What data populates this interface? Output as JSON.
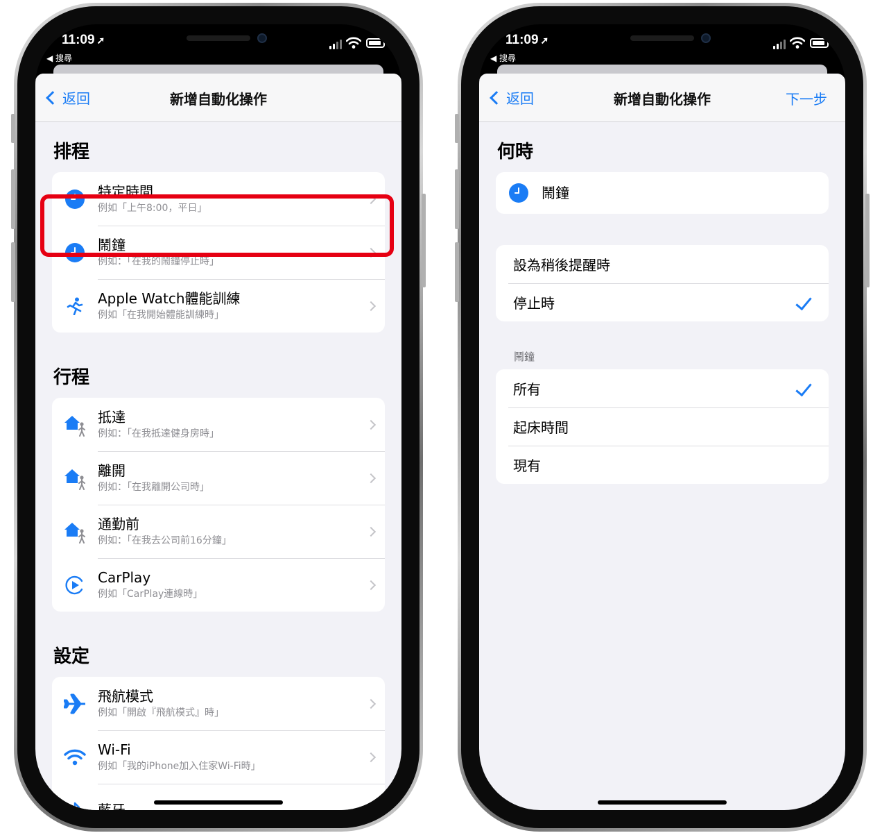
{
  "status_bar": {
    "time": "11:09",
    "back_app": "◀ 搜尋"
  },
  "left_screen": {
    "nav": {
      "back_label": "返回",
      "title": "新增自動化操作"
    },
    "sections": [
      {
        "header": "排程",
        "items": [
          {
            "icon": "clock-icon",
            "title": "特定時間",
            "subtitle": "例如「上午8:00，平日」"
          },
          {
            "icon": "clock-icon",
            "title": "鬧鐘",
            "subtitle": "例如：「在我的鬧鐘停止時」"
          },
          {
            "icon": "running-figure-icon",
            "title": "Apple Watch體能訓練",
            "subtitle": "例如「在我開始體能訓練時」"
          }
        ]
      },
      {
        "header": "行程",
        "items": [
          {
            "icon": "home-person-icon",
            "title": "抵達",
            "subtitle": "例如：「在我抵達健身房時」"
          },
          {
            "icon": "home-person-icon",
            "title": "離開",
            "subtitle": "例如：「在我離開公司時」"
          },
          {
            "icon": "home-person-icon",
            "title": "通勤前",
            "subtitle": "例如：「在我去公司前16分鐘」"
          },
          {
            "icon": "carplay-icon",
            "title": "CarPlay",
            "subtitle": "例如「CarPlay連線時」"
          }
        ]
      },
      {
        "header": "設定",
        "items": [
          {
            "icon": "airplane-icon",
            "title": "飛航模式",
            "subtitle": "例如「開啟『飛航模式』時」"
          },
          {
            "icon": "wifi-icon",
            "title": "Wi-Fi",
            "subtitle": "例如「我的iPhone加入住家Wi-Fi時」"
          },
          {
            "icon": "bluetooth-icon",
            "title": "藍牙",
            "subtitle": ""
          }
        ]
      }
    ]
  },
  "right_screen": {
    "nav": {
      "back_label": "返回",
      "title": "新增自動化操作",
      "next_label": "下一步"
    },
    "when_header": "何時",
    "trigger": {
      "icon": "clock-icon",
      "title": "鬧鐘"
    },
    "event_options": [
      {
        "label": "設為稍後提醒時",
        "checked": false
      },
      {
        "label": "停止時",
        "checked": true
      }
    ],
    "alarm_group_label": "鬧鐘",
    "alarm_options": [
      {
        "label": "所有",
        "checked": true
      },
      {
        "label": "起床時間",
        "checked": false
      },
      {
        "label": "現有",
        "checked": false
      }
    ]
  },
  "colors": {
    "accent": "#1a7cf5",
    "highlight": "#e60012",
    "background": "#f2f2f7"
  }
}
